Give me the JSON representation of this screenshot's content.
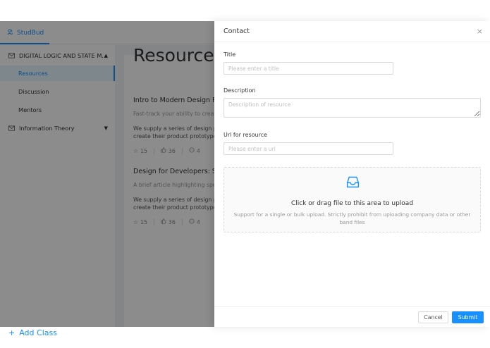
{
  "app": {
    "brand": "StudBud",
    "sidebar": {
      "groups": [
        {
          "label": "DIGITAL LOGIC AND STATE M...",
          "caret": "▲"
        },
        {
          "label": "Information Theory",
          "caret": "▼"
        }
      ],
      "items": [
        {
          "label": "Resources"
        },
        {
          "label": "Discussion"
        },
        {
          "label": "Mentors"
        }
      ],
      "add_class": "Add Class",
      "add_icon": "+"
    },
    "page_title": "Resource",
    "resources": [
      {
        "title": "Intro to Modern Design Pri",
        "subtitle": "Fast-track your ability to create",
        "desc_line1": "We supply a series of design p",
        "desc_line2": "create their product prototype",
        "stars": "15",
        "likes": "36",
        "comments": "4"
      },
      {
        "title": "Design for Developers: Spe",
        "subtitle": "A brief article highlighting spe",
        "desc_line1": "We supply a series of design p",
        "desc_line2": "create their product prototype",
        "stars": "15",
        "likes": "36",
        "comments": "4"
      }
    ]
  },
  "drawer": {
    "title": "Contact",
    "close_icon": "×",
    "fields": {
      "title_label": "Title",
      "title_placeholder": "Please enter a title",
      "description_label": "Description",
      "description_placeholder": "Description of resource",
      "url_label": "Url for resource",
      "url_placeholder": "Please enter a url"
    },
    "upload": {
      "text": "Click or drag file to this area to upload",
      "hint": "Support for a single or bulk upload. Strictly prohibit from uploading company data or other band files"
    },
    "footer": {
      "cancel": "Cancel",
      "submit": "Submit"
    }
  },
  "colors": {
    "accent": "#1890ff",
    "mask": "rgba(0,0,0,0.45)"
  }
}
